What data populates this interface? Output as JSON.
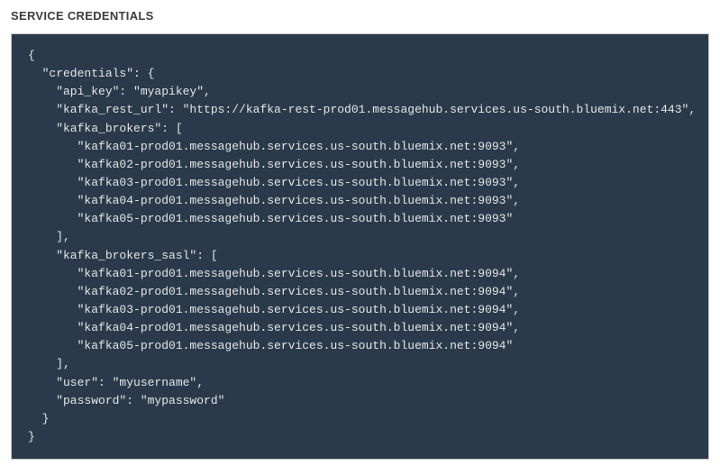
{
  "heading": "SERVICE CREDENTIALS",
  "credentials": {
    "api_key": "myapikey",
    "kafka_rest_url": "https://kafka-rest-prod01.messagehub.services.us-south.bluemix.net:443",
    "kafka_brokers": [
      "kafka01-prod01.messagehub.services.us-south.bluemix.net:9093",
      "kafka02-prod01.messagehub.services.us-south.bluemix.net:9093",
      "kafka03-prod01.messagehub.services.us-south.bluemix.net:9093",
      "kafka04-prod01.messagehub.services.us-south.bluemix.net:9093",
      "kafka05-prod01.messagehub.services.us-south.bluemix.net:9093"
    ],
    "kafka_brokers_sasl": [
      "kafka01-prod01.messagehub.services.us-south.bluemix.net:9094",
      "kafka02-prod01.messagehub.services.us-south.bluemix.net:9094",
      "kafka03-prod01.messagehub.services.us-south.bluemix.net:9094",
      "kafka04-prod01.messagehub.services.us-south.bluemix.net:9094",
      "kafka05-prod01.messagehub.services.us-south.bluemix.net:9094"
    ],
    "user": "myusername",
    "password": "mypassword"
  }
}
